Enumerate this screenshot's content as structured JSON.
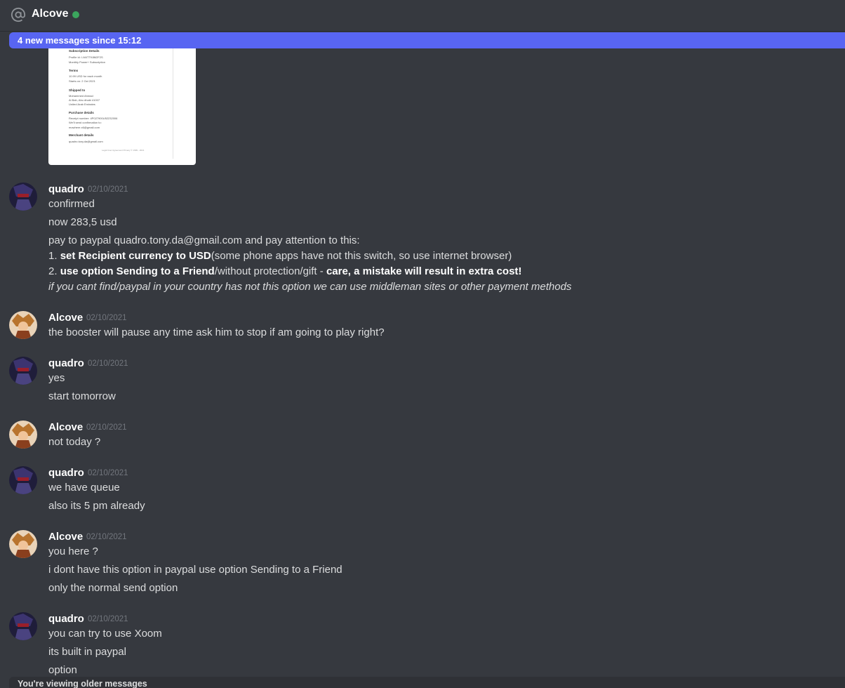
{
  "header": {
    "title": "Alcove",
    "icon": "at-icon",
    "status_color": "#3ba55d"
  },
  "new_messages_bar": "4 new messages since 15:12",
  "older_messages_bar": "You're viewing older messages",
  "receipt": {
    "subscription_heading": "Subscription Details",
    "profile": "Profile Id: I-M4TTK8M2F2S",
    "plan": "Monthly Power+ Subscription",
    "terms_heading": "Terms",
    "terms_1": "10.99 USD for each month",
    "terms_2": "Starts on: 2 Oct 2021",
    "shipped_heading": "Shipped to",
    "ship_1": "Mohammed Ahmad",
    "ship_2": "Al Bah, Abu dhabi 41007",
    "ship_3": "United Arab Emirates",
    "purchase_heading": "Purchase details",
    "purchase_1": "Receipt number: 4P027900U52232006",
    "purchase_2": "We'll send confirmation to:",
    "purchase_3": "mowhere.x6@gmail.com",
    "merchant_heading": "Merchant details",
    "merchant_1": "quadro.tony.da@gmail.com",
    "footer": "Legal   User Agreement   Privacy   © 1999 - 2021"
  },
  "messages": [
    {
      "author": "quadro",
      "time": "02/10/2021",
      "l1": "confirmed",
      "l2": "now 283,5 usd",
      "l3": "pay to paypal quadro.tony.da@gmail.com  and pay attention to this:",
      "l4a": "1. ",
      "l4b": "set Recipient currency to USD",
      "l4c": "(some phone apps have not this switch, so use internet browser)",
      "l5a": "2. ",
      "l5b": "use option Sending to a Friend",
      "l5c": "/without protection/gift - ",
      "l5d": "care, a mistake will result in extra cost!",
      "l6": "if you cant find/paypal in your country has not this option we can use middleman sites or other payment methods"
    },
    {
      "author": "Alcove",
      "time": "02/10/2021",
      "l1": "the booster will pause any time ask him to stop if am going to play right?"
    },
    {
      "author": "quadro",
      "time": "02/10/2021",
      "l1": "yes",
      "l2": "start tomorrow"
    },
    {
      "author": "Alcove",
      "time": "02/10/2021",
      "l1": "not today ?"
    },
    {
      "author": "quadro",
      "time": "02/10/2021",
      "l1": "we have queue",
      "l2": "also its 5 pm already"
    },
    {
      "author": "Alcove",
      "time": "02/10/2021",
      "l1": "you here ?",
      "l2": "i dont have this option in paypal  use option Sending to a Friend",
      "l3": "only the normal send option"
    },
    {
      "author": "quadro",
      "time": "02/10/2021",
      "l1": "you can try to use Xoom",
      "l2": "its built in paypal",
      "l3": "option"
    }
  ]
}
